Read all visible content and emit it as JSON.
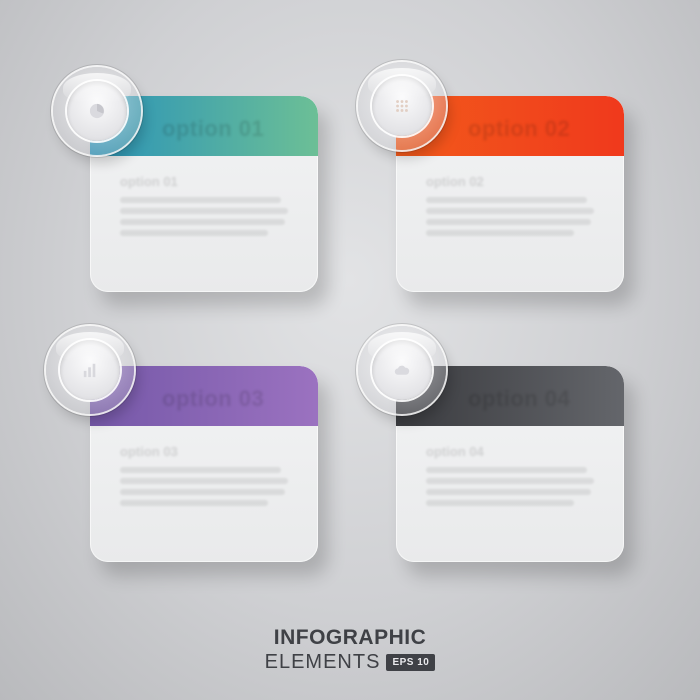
{
  "cards": [
    {
      "header_title": "option 01",
      "body_title": "option 01",
      "color_start": "#2a93b8",
      "color_end": "#6cbf96",
      "icon": "pie-chart-icon"
    },
    {
      "header_title": "option 02",
      "body_title": "option 02",
      "color_start": "#f25a1b",
      "color_end": "#f0391c",
      "icon": "grid-icon"
    },
    {
      "header_title": "option 03",
      "body_title": "option 03",
      "color_start": "#7558a8",
      "color_end": "#9b72c0",
      "icon": "bar-chart-icon"
    },
    {
      "header_title": "option 04",
      "body_title": "option 04",
      "color_start": "#3a3b3f",
      "color_end": "#64666b",
      "icon": "cloud-icon"
    }
  ],
  "footer": {
    "title": "INFOGRAPHIC",
    "subtitle": "ELEMENTS",
    "badge": "EPS 10"
  }
}
